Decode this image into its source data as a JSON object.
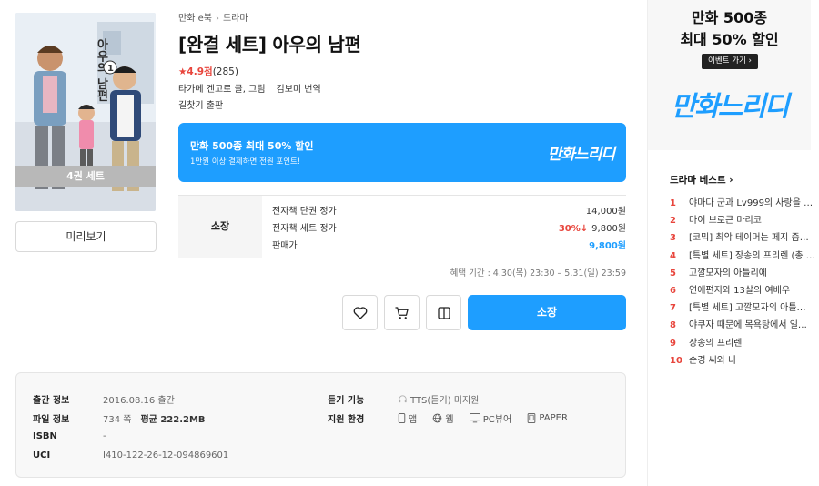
{
  "cover": {
    "set_badge": "4권 세트",
    "title_art": "아우의 남편",
    "volume": "1"
  },
  "preview_label": "미리보기",
  "breadcrumb": [
    "만화 e북",
    "드라마"
  ],
  "title": "[완결 세트] 아우의 남편",
  "rating": {
    "score": "4.9점",
    "count": "(285)"
  },
  "authors": {
    "author": "타가메 겐고로 글, 그림",
    "translator": "김보미 번역"
  },
  "publisher": "길찾기 출판",
  "promo": {
    "title": "만화 500종 최대 50% 할인",
    "subtitle": "1만원 이상 결제하면 전원 포인트!",
    "logo": "만화느리디"
  },
  "price": {
    "section_label": "소장",
    "rows": [
      {
        "label": "전자책 단권 정가",
        "value": "14,000원"
      },
      {
        "label": "전자책 세트 정가",
        "discount": "30%↓",
        "value": "9,800원"
      },
      {
        "label": "판매가",
        "value": "9,800원"
      }
    ],
    "period": "혜택 기간 : 4.30(목) 23:30 – 5.31(일) 23:59"
  },
  "actions": {
    "buy_label": "소장"
  },
  "info": {
    "release_label": "출간 정보",
    "release_value": "2016.08.16 출간",
    "file_label": "파일 정보",
    "file_pages": "734 쪽",
    "file_size": "평균 222.2MB",
    "isbn_label": "ISBN",
    "isbn_value": "-",
    "uci_label": "UCI",
    "uci_value": "I410-122-26-12-094869601",
    "listen_label": "듣기 기능",
    "listen_value": "TTS(듣기) 미지원",
    "env_label": "지원 환경",
    "env_items": [
      "앱",
      "웹",
      "PC뷰어",
      "PAPER"
    ]
  },
  "side_ad": {
    "line1": "만화 500종",
    "line2": "최대 50% 할인",
    "button": "이벤트 가기 ›",
    "logo": "만화느리디"
  },
  "best": {
    "title": "드라마 베스트 ›",
    "items": [
      {
        "rank": "1",
        "title": "야마다 군과 Lv999의 사랑을 …"
      },
      {
        "rank": "2",
        "title": "마이 브로큰 마리코"
      },
      {
        "rank": "3",
        "title": "[코믹] 최악 테이머는 페지 즘…"
      },
      {
        "rank": "4",
        "title": "[특별 세트] 장송의 프리렌 (총 …"
      },
      {
        "rank": "5",
        "title": "고깔모자의 아틀리에"
      },
      {
        "rank": "6",
        "title": "연애편지와 13살의 여배우"
      },
      {
        "rank": "7",
        "title": "[특별 세트] 고깔모자의 아틀…"
      },
      {
        "rank": "8",
        "title": "야쿠자 때문에 목욕탕에서 일…"
      },
      {
        "rank": "9",
        "title": "장송의 프리렌"
      },
      {
        "rank": "10",
        "title": "순경 씨와 나"
      }
    ]
  },
  "colors": {
    "accent": "#1e9eff",
    "sale": "#e8453c"
  }
}
